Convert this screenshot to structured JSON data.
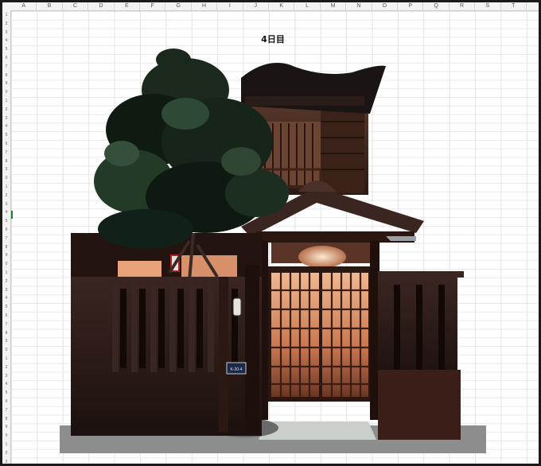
{
  "sheet": {
    "title": "4日目",
    "columns": [
      "A",
      "B",
      "C",
      "D",
      "E",
      "F",
      "G",
      "H",
      "I",
      "J",
      "K",
      "L",
      "M",
      "N",
      "O",
      "P",
      "Q",
      "R",
      "S",
      "T"
    ],
    "rows": [
      "1",
      "2",
      "3",
      "4",
      "5",
      "6",
      "7",
      "8",
      "9",
      "0",
      "1",
      "2",
      "3",
      "4",
      "5",
      "6",
      "7",
      "8",
      "9",
      "0",
      "1",
      "2",
      "3",
      "4",
      "5",
      "6",
      "7",
      "8",
      "9",
      "0",
      "1",
      "2",
      "3",
      "4",
      "5",
      "6",
      "7",
      "8",
      "9",
      "0",
      "1",
      "2",
      "3",
      "4",
      "5",
      "6",
      "7",
      "8",
      "9",
      "0",
      "1",
      "2",
      "3"
    ]
  },
  "artwork": {
    "subject": "Japanese machiya townhouse at dusk",
    "nameplate_text": "K-20-4",
    "colors": {
      "wood_dark": "#2a1712",
      "wood_mid": "#4b2c22",
      "lantern_glow": "#f2b58a",
      "tree_dark": "#101a12",
      "tree_mid": "#2d4a33",
      "roof": "#1b1414",
      "ground": "#8a8a8a"
    }
  }
}
